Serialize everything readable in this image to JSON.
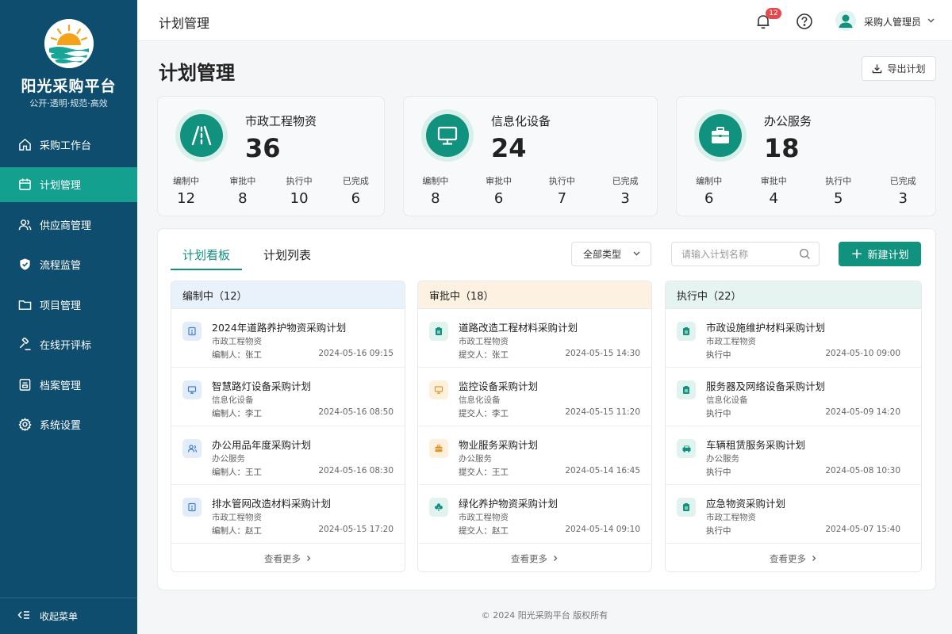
{
  "brand": {
    "name": "阳光采购平台",
    "slogan": "公开·透明·规范·高效"
  },
  "nav": [
    {
      "label": "采购工作台",
      "icon": "home-icon",
      "active": false
    },
    {
      "label": "计划管理",
      "icon": "calendar-icon",
      "active": true
    },
    {
      "label": "供应商管理",
      "icon": "users-icon",
      "active": false
    },
    {
      "label": "流程监管",
      "icon": "shield-icon",
      "active": false
    },
    {
      "label": "项目管理",
      "icon": "folder-icon",
      "active": false
    },
    {
      "label": "在线开评标",
      "icon": "gavel-icon",
      "active": false
    },
    {
      "label": "档案管理",
      "icon": "archive-icon",
      "active": false
    },
    {
      "label": "系统设置",
      "icon": "gear-icon",
      "active": false
    }
  ],
  "collapse_label": "收起菜单",
  "header": {
    "title": "计划管理",
    "notification_count": "12",
    "user_name": "采购人管理员"
  },
  "page": {
    "title": "计划管理",
    "export_label": "导出计划"
  },
  "stats": [
    {
      "name": "市政工程物资",
      "total": "36",
      "icon": "road-icon",
      "subs": [
        {
          "label": "编制中",
          "value": "12"
        },
        {
          "label": "审批中",
          "value": "8"
        },
        {
          "label": "执行中",
          "value": "10"
        },
        {
          "label": "已完成",
          "value": "6"
        }
      ]
    },
    {
      "name": "信息化设备",
      "total": "24",
      "icon": "monitor-icon",
      "subs": [
        {
          "label": "编制中",
          "value": "8"
        },
        {
          "label": "审批中",
          "value": "6"
        },
        {
          "label": "执行中",
          "value": "7"
        },
        {
          "label": "已完成",
          "value": "3"
        }
      ]
    },
    {
      "name": "办公服务",
      "total": "18",
      "icon": "briefcase-icon",
      "subs": [
        {
          "label": "编制中",
          "value": "6"
        },
        {
          "label": "审批中",
          "value": "4"
        },
        {
          "label": "执行中",
          "value": "5"
        },
        {
          "label": "已完成",
          "value": "3"
        }
      ]
    }
  ],
  "tabs": [
    {
      "label": "计划看板"
    },
    {
      "label": "计划列表"
    }
  ],
  "filter": {
    "type_label": "全部类型",
    "search_placeholder": "请输入计划名称",
    "new_label": "新建计划"
  },
  "columns": [
    {
      "title": "编制中（12）",
      "head_bg": "#e9f1fb",
      "more": "查看更多",
      "cards": [
        {
          "title": "2024年道路养护物资采购计划",
          "category": "市政工程物资",
          "person": "编制人：张工",
          "date": "2024-05-16 09:15",
          "icon": "file-icon",
          "icon_bg": "#e3edf9",
          "icon_color": "#3b7dd8"
        },
        {
          "title": "智慧路灯设备采购计划",
          "category": "信息化设备",
          "person": "编制人：李工",
          "date": "2024-05-16 08:50",
          "icon": "monitor-icon",
          "icon_bg": "#e3edf9",
          "icon_color": "#3b7dd8"
        },
        {
          "title": "办公用品年度采购计划",
          "category": "办公服务",
          "person": "编制人：王工",
          "date": "2024-05-16 08:30",
          "icon": "users-icon",
          "icon_bg": "#e3edf9",
          "icon_color": "#3b7dd8"
        },
        {
          "title": "排水管网改造材料采购计划",
          "category": "市政工程物资",
          "person": "编制人：赵工",
          "date": "2024-05-15 17:20",
          "icon": "file-icon",
          "icon_bg": "#e3edf9",
          "icon_color": "#3b7dd8"
        }
      ]
    },
    {
      "title": "审批中（18）",
      "head_bg": "#fdf2e2",
      "more": "查看更多",
      "cards": [
        {
          "title": "道路改造工程材料采购计划",
          "category": "市政工程物资",
          "person": "提交人：张工",
          "date": "2024-05-15 14:30",
          "icon": "clipboard-icon",
          "icon_bg": "#e0f3ef",
          "icon_color": "#11927f"
        },
        {
          "title": "监控设备采购计划",
          "category": "信息化设备",
          "person": "提交人：李工",
          "date": "2024-05-15 11:20",
          "icon": "monitor-icon",
          "icon_bg": "#fdf0dc",
          "icon_color": "#e0962b"
        },
        {
          "title": "物业服务采购计划",
          "category": "办公服务",
          "person": "提交人：王工",
          "date": "2024-05-14 16:45",
          "icon": "briefcase-icon",
          "icon_bg": "#fdf0dc",
          "icon_color": "#e0962b"
        },
        {
          "title": "绿化养护物资采购计划",
          "category": "市政工程物资",
          "person": "提交人：赵工",
          "date": "2024-05-14 09:10",
          "icon": "leaf-icon",
          "icon_bg": "#e0f3ef",
          "icon_color": "#11927f"
        }
      ]
    },
    {
      "title": "执行中（22）",
      "head_bg": "#e5f4f0",
      "more": "查看更多",
      "cards": [
        {
          "title": "市政设施维护材料采购计划",
          "category": "市政工程物资",
          "person": "执行中",
          "date": "2024-05-10 09:00",
          "icon": "clipboard-icon",
          "icon_bg": "#e0f3ef",
          "icon_color": "#11927f"
        },
        {
          "title": "服务器及网络设备采购计划",
          "category": "信息化设备",
          "person": "执行中",
          "date": "2024-05-09 14:20",
          "icon": "clipboard-icon",
          "icon_bg": "#e0f3ef",
          "icon_color": "#11927f"
        },
        {
          "title": "车辆租赁服务采购计划",
          "category": "办公服务",
          "person": "执行中",
          "date": "2024-05-08 10:30",
          "icon": "car-icon",
          "icon_bg": "#e0f3ef",
          "icon_color": "#11927f"
        },
        {
          "title": "应急物资采购计划",
          "category": "市政工程物资",
          "person": "执行中",
          "date": "2024-05-07 15:40",
          "icon": "clipboard-icon",
          "icon_bg": "#e0f3ef",
          "icon_color": "#11927f"
        }
      ]
    }
  ],
  "footer": "© 2024 阳光采购平台 版权所有"
}
